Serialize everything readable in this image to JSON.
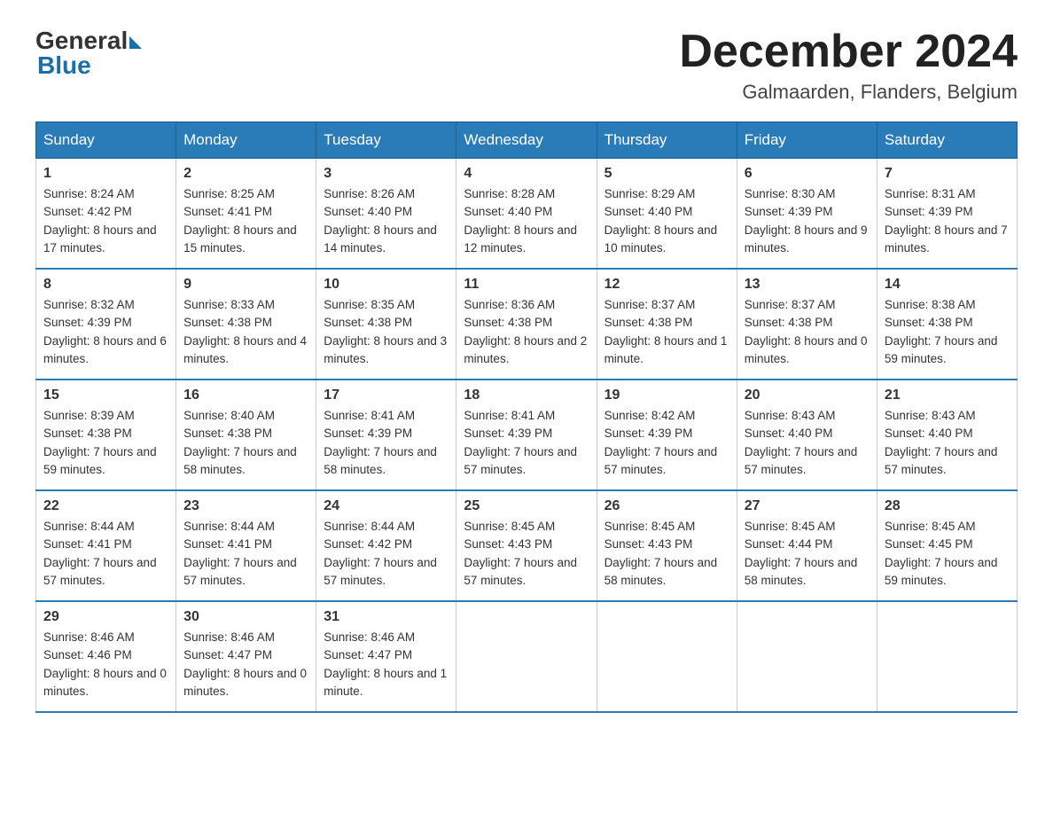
{
  "logo": {
    "general": "General",
    "blue": "Blue"
  },
  "title": "December 2024",
  "location": "Galmaarden, Flanders, Belgium",
  "headers": [
    "Sunday",
    "Monday",
    "Tuesday",
    "Wednesday",
    "Thursday",
    "Friday",
    "Saturday"
  ],
  "weeks": [
    [
      {
        "day": "1",
        "sunrise": "8:24 AM",
        "sunset": "4:42 PM",
        "daylight": "8 hours and 17 minutes."
      },
      {
        "day": "2",
        "sunrise": "8:25 AM",
        "sunset": "4:41 PM",
        "daylight": "8 hours and 15 minutes."
      },
      {
        "day": "3",
        "sunrise": "8:26 AM",
        "sunset": "4:40 PM",
        "daylight": "8 hours and 14 minutes."
      },
      {
        "day": "4",
        "sunrise": "8:28 AM",
        "sunset": "4:40 PM",
        "daylight": "8 hours and 12 minutes."
      },
      {
        "day": "5",
        "sunrise": "8:29 AM",
        "sunset": "4:40 PM",
        "daylight": "8 hours and 10 minutes."
      },
      {
        "day": "6",
        "sunrise": "8:30 AM",
        "sunset": "4:39 PM",
        "daylight": "8 hours and 9 minutes."
      },
      {
        "day": "7",
        "sunrise": "8:31 AM",
        "sunset": "4:39 PM",
        "daylight": "8 hours and 7 minutes."
      }
    ],
    [
      {
        "day": "8",
        "sunrise": "8:32 AM",
        "sunset": "4:39 PM",
        "daylight": "8 hours and 6 minutes."
      },
      {
        "day": "9",
        "sunrise": "8:33 AM",
        "sunset": "4:38 PM",
        "daylight": "8 hours and 4 minutes."
      },
      {
        "day": "10",
        "sunrise": "8:35 AM",
        "sunset": "4:38 PM",
        "daylight": "8 hours and 3 minutes."
      },
      {
        "day": "11",
        "sunrise": "8:36 AM",
        "sunset": "4:38 PM",
        "daylight": "8 hours and 2 minutes."
      },
      {
        "day": "12",
        "sunrise": "8:37 AM",
        "sunset": "4:38 PM",
        "daylight": "8 hours and 1 minute."
      },
      {
        "day": "13",
        "sunrise": "8:37 AM",
        "sunset": "4:38 PM",
        "daylight": "8 hours and 0 minutes."
      },
      {
        "day": "14",
        "sunrise": "8:38 AM",
        "sunset": "4:38 PM",
        "daylight": "7 hours and 59 minutes."
      }
    ],
    [
      {
        "day": "15",
        "sunrise": "8:39 AM",
        "sunset": "4:38 PM",
        "daylight": "7 hours and 59 minutes."
      },
      {
        "day": "16",
        "sunrise": "8:40 AM",
        "sunset": "4:38 PM",
        "daylight": "7 hours and 58 minutes."
      },
      {
        "day": "17",
        "sunrise": "8:41 AM",
        "sunset": "4:39 PM",
        "daylight": "7 hours and 58 minutes."
      },
      {
        "day": "18",
        "sunrise": "8:41 AM",
        "sunset": "4:39 PM",
        "daylight": "7 hours and 57 minutes."
      },
      {
        "day": "19",
        "sunrise": "8:42 AM",
        "sunset": "4:39 PM",
        "daylight": "7 hours and 57 minutes."
      },
      {
        "day": "20",
        "sunrise": "8:43 AM",
        "sunset": "4:40 PM",
        "daylight": "7 hours and 57 minutes."
      },
      {
        "day": "21",
        "sunrise": "8:43 AM",
        "sunset": "4:40 PM",
        "daylight": "7 hours and 57 minutes."
      }
    ],
    [
      {
        "day": "22",
        "sunrise": "8:44 AM",
        "sunset": "4:41 PM",
        "daylight": "7 hours and 57 minutes."
      },
      {
        "day": "23",
        "sunrise": "8:44 AM",
        "sunset": "4:41 PM",
        "daylight": "7 hours and 57 minutes."
      },
      {
        "day": "24",
        "sunrise": "8:44 AM",
        "sunset": "4:42 PM",
        "daylight": "7 hours and 57 minutes."
      },
      {
        "day": "25",
        "sunrise": "8:45 AM",
        "sunset": "4:43 PM",
        "daylight": "7 hours and 57 minutes."
      },
      {
        "day": "26",
        "sunrise": "8:45 AM",
        "sunset": "4:43 PM",
        "daylight": "7 hours and 58 minutes."
      },
      {
        "day": "27",
        "sunrise": "8:45 AM",
        "sunset": "4:44 PM",
        "daylight": "7 hours and 58 minutes."
      },
      {
        "day": "28",
        "sunrise": "8:45 AM",
        "sunset": "4:45 PM",
        "daylight": "7 hours and 59 minutes."
      }
    ],
    [
      {
        "day": "29",
        "sunrise": "8:46 AM",
        "sunset": "4:46 PM",
        "daylight": "8 hours and 0 minutes."
      },
      {
        "day": "30",
        "sunrise": "8:46 AM",
        "sunset": "4:47 PM",
        "daylight": "8 hours and 0 minutes."
      },
      {
        "day": "31",
        "sunrise": "8:46 AM",
        "sunset": "4:47 PM",
        "daylight": "8 hours and 1 minute."
      },
      null,
      null,
      null,
      null
    ]
  ]
}
